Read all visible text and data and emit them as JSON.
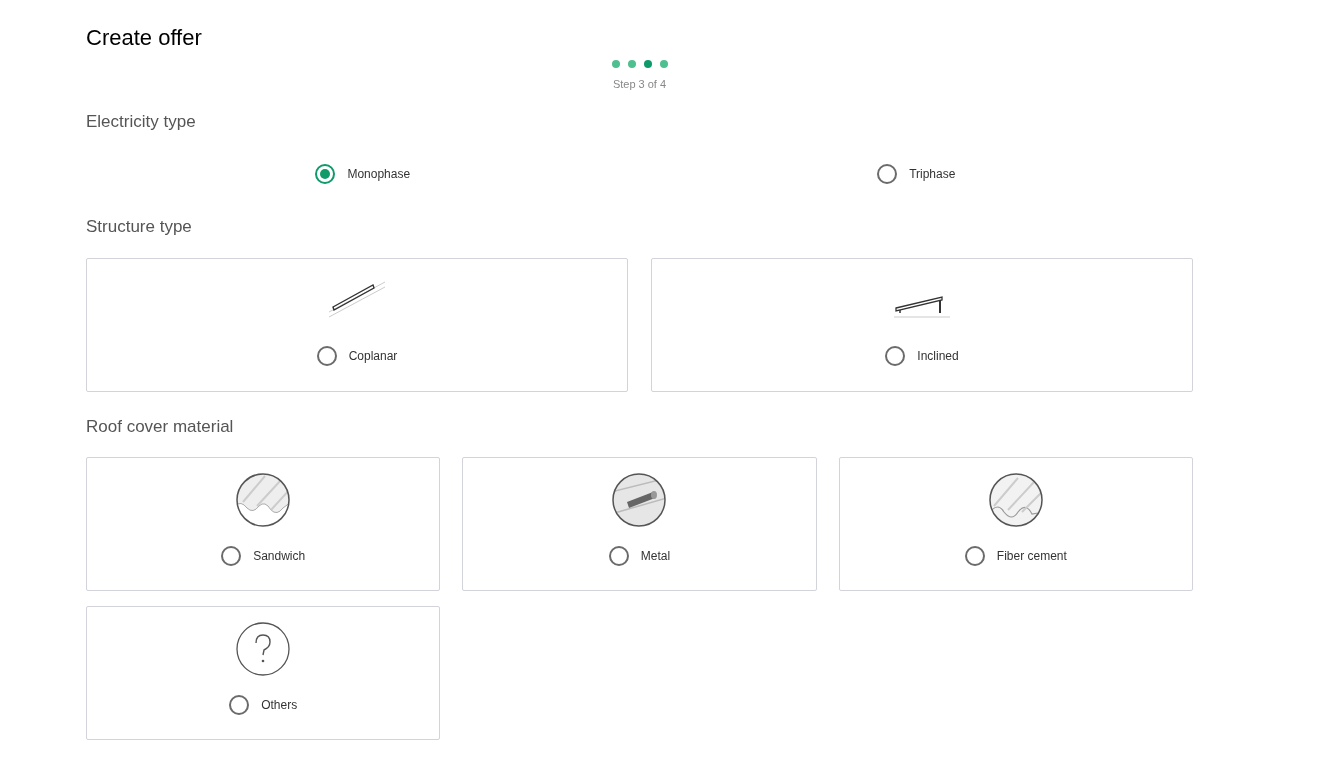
{
  "title": "Create offer",
  "steps": [
    {
      "selected": false
    },
    {
      "selected": false
    },
    {
      "selected": true
    },
    {
      "selected": false
    }
  ],
  "step_label": "Step 3 of 4",
  "electricity": {
    "heading": "Electricity type",
    "options": [
      {
        "label": "Monophase",
        "selected": true
      },
      {
        "label": "Triphase",
        "selected": false
      }
    ]
  },
  "structure": {
    "heading": "Structure type",
    "options": [
      {
        "label": "Coplanar",
        "selected": false,
        "kind": "coplanar"
      },
      {
        "label": "Inclined",
        "selected": false,
        "kind": "inclined"
      }
    ]
  },
  "roof": {
    "heading": "Roof cover material",
    "options": [
      {
        "label": "Sandwich",
        "selected": false,
        "kind": "sandwich"
      },
      {
        "label": "Metal",
        "selected": false,
        "kind": "metal"
      },
      {
        "label": "Fiber cement",
        "selected": false,
        "kind": "fiber"
      },
      {
        "label": "Others",
        "selected": false,
        "kind": "others"
      }
    ]
  }
}
